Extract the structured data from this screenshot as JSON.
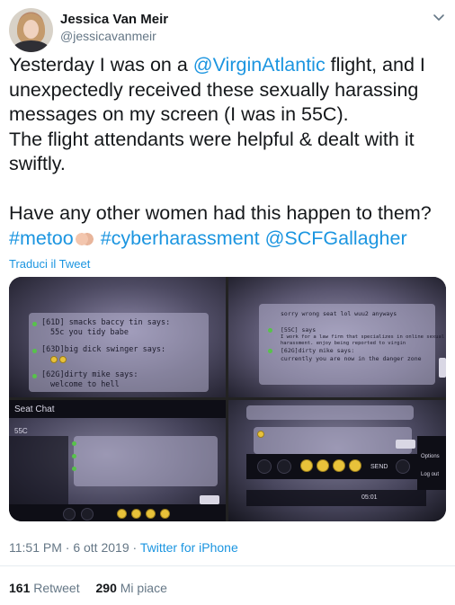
{
  "user": {
    "name": "Jessica Van Meir",
    "handle": "@jessicavanmeir"
  },
  "tweet": {
    "line1_pre": "Yesterday I was on a ",
    "line1_mention": "@VirginAtlantic",
    "line1_post": " flight, and I",
    "line2": "unexpectedly received these sexually harassing",
    "line3": "messages on my screen (I was in 55C).",
    "line4": "The flight attendants were helpful & dealt with it",
    "line5": "swiftly.",
    "line6": "Have any other women had this happen to them?",
    "hashtag1": "#metoo",
    "hashtag2": "#cyberharassment",
    "mention2": "@SCFGallagher"
  },
  "translate_label": "Traduci il Tweet",
  "media": {
    "photo1": {
      "m1_sender": "[61D] smacks baccy tin says:",
      "m1_body": "55c you tidy babe",
      "m2_sender": "[63D]big dick swinger says:",
      "m3_sender": "[62G]dirty mike says:",
      "m3_body": "welcome to hell"
    },
    "photo2": {
      "line_a": "sorry wrong seat lol wuu2 anyways",
      "line_b": "[55C] says",
      "line_c": "I work for a law firm that specializes in online sexual",
      "line_d": "harassment. enjoy being reported to virgin",
      "line_e": "[62G]dirty mike says:",
      "line_f": "currently you are now in the danger zone"
    },
    "photo3": {
      "title": "Seat Chat",
      "seat": "55C"
    },
    "photo4": {
      "send": "SEND",
      "options": "Options",
      "logout": "Log out",
      "time": "05:01"
    }
  },
  "meta": {
    "time": "11:51 PM · 6 ott 2019",
    "separator": " · ",
    "source": "Twitter for iPhone"
  },
  "stats": {
    "retweets": "161",
    "retweets_label": "Retweet",
    "likes": "290",
    "likes_label": "Mi piace"
  }
}
